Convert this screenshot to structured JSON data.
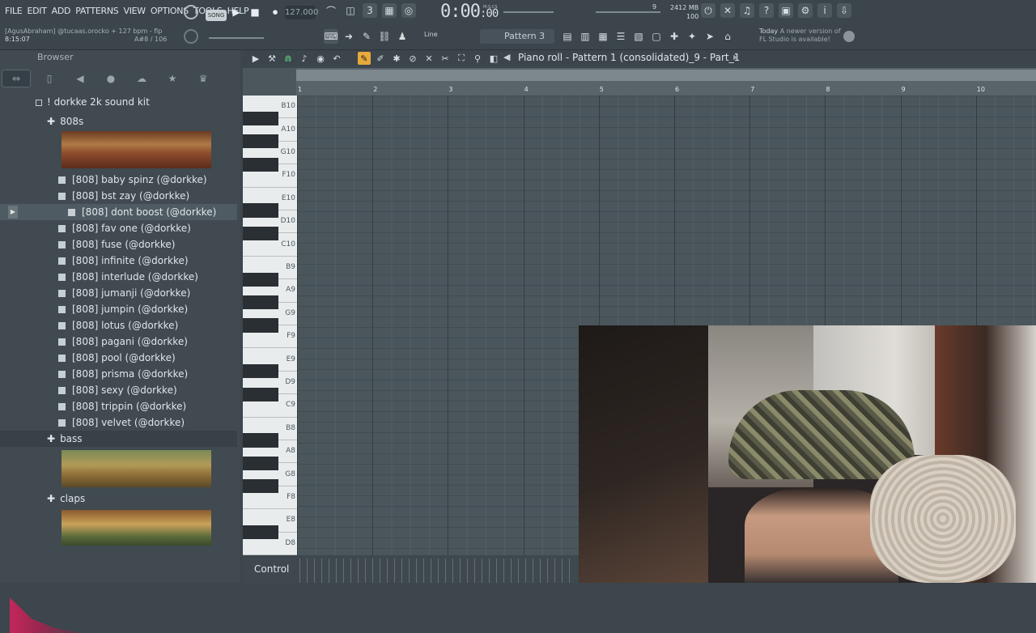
{
  "menu": [
    "FILE",
    "EDIT",
    "ADD",
    "PATTERNS",
    "VIEW",
    "OPTIONS",
    "TOOLS",
    "HELP"
  ],
  "song_info": {
    "line1": "[AgusAbraham] @tucaas.orocko + 127 bpm - flp",
    "time": "8:15:07",
    "note": "A#8 / 106"
  },
  "transport": {
    "song_label": "SONG",
    "tempo": "127.000",
    "time": "0:00",
    "time_cs": ":00",
    "time_unit": "M:S:CS"
  },
  "system": {
    "ram": "2412 MB",
    "poly": "100",
    "cpu": "9"
  },
  "news": {
    "label": "Today",
    "text": "A newer version of",
    "text2": "FL Studio is available!"
  },
  "toolbar": {
    "snap": "Line",
    "pattern": "Pattern 3"
  },
  "browser": {
    "title": "Browser",
    "root": "! dorkke 2k sound kit",
    "folders": [
      {
        "label": "808s"
      },
      {
        "label": "bass"
      },
      {
        "label": "claps"
      }
    ],
    "files": [
      "[808] baby spinz (@dorkke)",
      "[808] bst zay (@dorkke)",
      "[808] dont boost (@dorkke)",
      "[808] fav one (@dorkke)",
      "[808] fuse (@dorkke)",
      "[808] infinite (@dorkke)",
      "[808] interlude (@dorkke)",
      "[808] jumanji (@dorkke)",
      "[808] jumpin (@dorkke)",
      "[808] lotus (@dorkke)",
      "[808] pagani (@dorkke)",
      "[808] pool (@dorkke)",
      "[808] prisma (@dorkke)",
      "[808] sexy (@dorkke)",
      "[808] trippin (@dorkke)",
      "[808] velvet (@dorkke)"
    ]
  },
  "piano_roll": {
    "title": "Piano roll - Pattern 1 (consolidated)_9 - Part_1",
    "bars": [
      "1",
      "2",
      "3",
      "4",
      "5",
      "6",
      "7",
      "8",
      "9",
      "10"
    ],
    "key_labels": [
      "B10",
      "A10",
      "G10",
      "F10",
      "E10",
      "D10",
      "C10",
      "B9",
      "A9",
      "G9",
      "F9",
      "E9",
      "D9",
      "C9",
      "B8",
      "A8",
      "G8",
      "F8",
      "E8",
      "D8"
    ],
    "control_label": "Control"
  }
}
